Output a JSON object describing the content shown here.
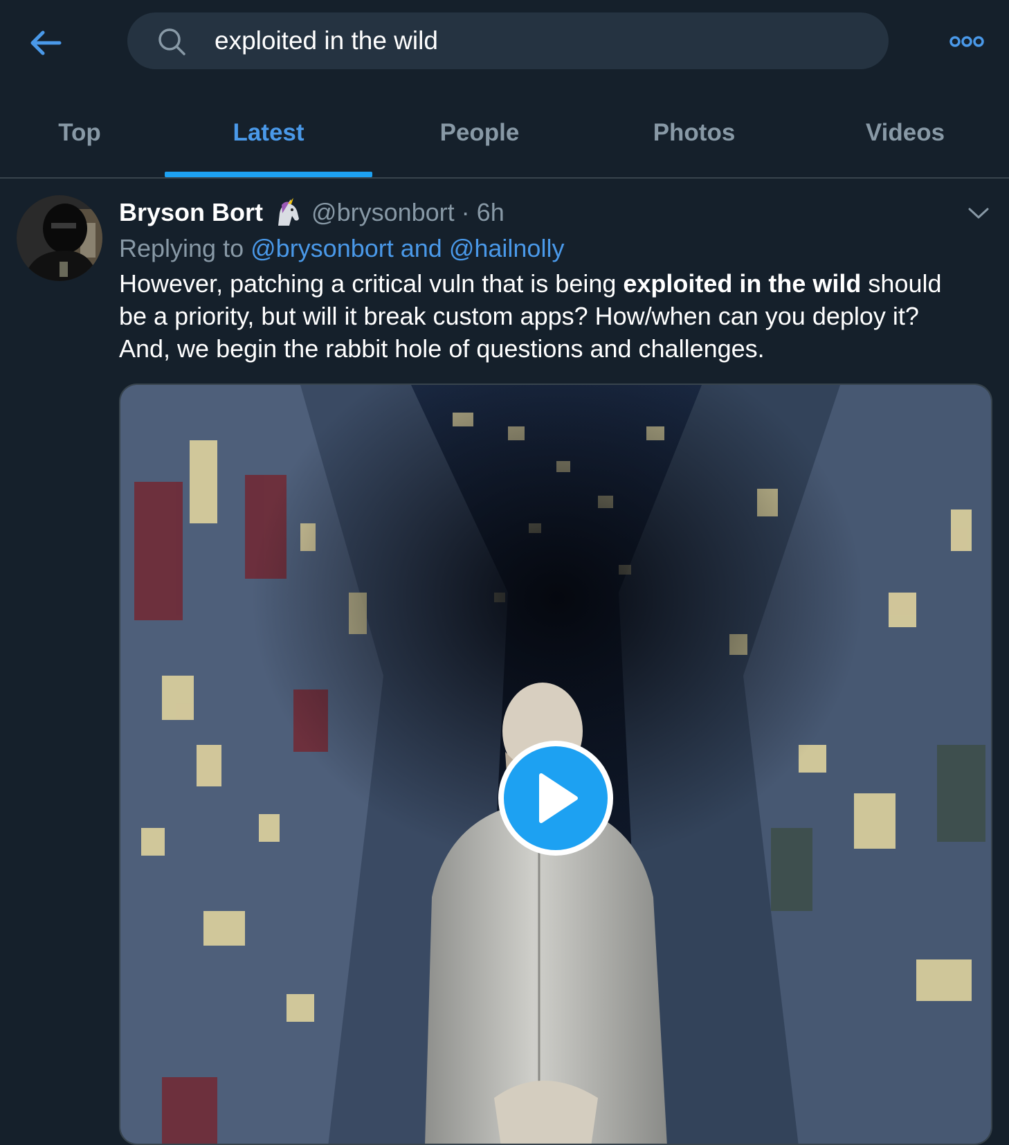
{
  "search": {
    "query": "exploited in the wild"
  },
  "tabs": [
    {
      "label": "Top"
    },
    {
      "label": "Latest"
    },
    {
      "label": "People"
    },
    {
      "label": "Photos"
    },
    {
      "label": "Videos"
    }
  ],
  "active_tab": "Latest",
  "tweet": {
    "author_name": "Bryson Bort",
    "emoji": "unicorn",
    "handle": "@brysonbort",
    "separator": "·",
    "time": "6h",
    "replying_prefix": "Replying to",
    "replying_to": "@brysonbort and @hailnolly",
    "text_before": "However, patching a critical vuln that is being ",
    "text_bold": "exploited in the wild",
    "text_after": " should be a priority, but will it break custom apps? How/when can you deploy it? And, we begin the rabbit hole of questions and challenges."
  },
  "icons": {
    "back": "arrow-left-icon",
    "search": "search-icon",
    "more": "more-icon",
    "caret": "chevron-down-icon",
    "play": "play-icon"
  },
  "colors": {
    "background": "#15202b",
    "accent": "#1da1f2",
    "link": "#4a99e9",
    "muted": "#8899a6",
    "search_bg": "#253341",
    "divider": "#38444d"
  }
}
